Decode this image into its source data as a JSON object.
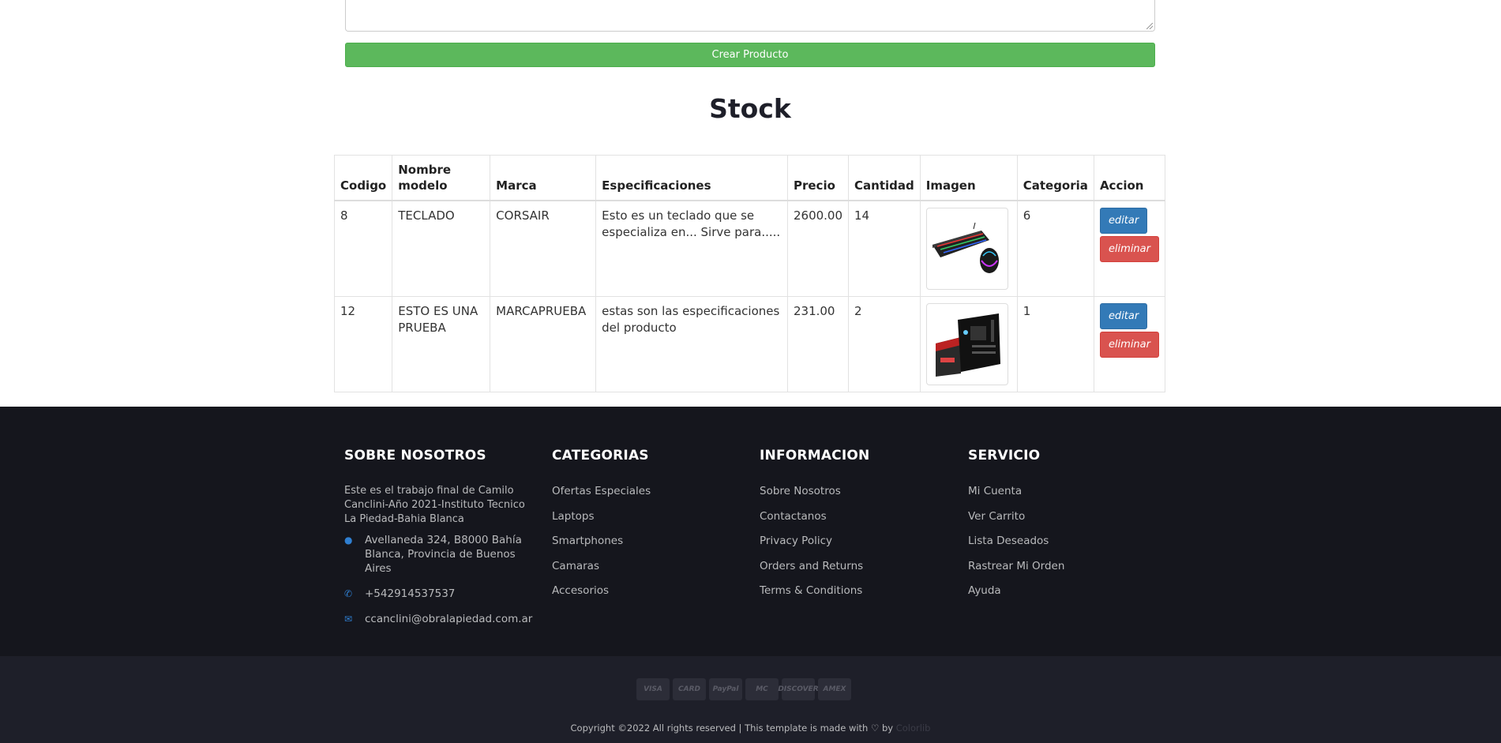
{
  "form": {
    "create_button": "Crear Producto"
  },
  "stock": {
    "title": "Stock",
    "columns": [
      "Codigo",
      "Nombre modelo",
      "Marca",
      "Especificaciones",
      "Precio",
      "Cantidad",
      "Imagen",
      "Categoria",
      "Accion"
    ],
    "rows": [
      {
        "codigo": "8",
        "nombre": "TECLADO",
        "marca": "CORSAIR",
        "especificaciones": "Esto es un teclado que se especializa en... Sirve para.....",
        "precio": "2600.00",
        "cantidad": "14",
        "imagen": "keyboard-mouse-icon",
        "categoria": "6",
        "edit_label": "editar",
        "delete_label": "eliminar"
      },
      {
        "codigo": "12",
        "nombre": "ESTO ES UNA PRUEBA",
        "marca": "MARCAPRUEBA",
        "especificaciones": "estas son las especificaciones del producto",
        "precio": "231.00",
        "cantidad": "2",
        "imagen": "motherboard-box-icon",
        "categoria": "1",
        "edit_label": "editar",
        "delete_label": "eliminar"
      }
    ]
  },
  "footer": {
    "about": {
      "heading": "SOBRE NOSOTROS",
      "text": "Este es el trabajo final de Camilo Canclini-Año 2021-Instituto Tecnico La Piedad-Bahia Blanca",
      "address": "Avellaneda 324, B8000 Bahía Blanca, Provincia de Buenos Aires",
      "phone": "+542914537537",
      "email": "ccanclini@obralapiedad.com.ar"
    },
    "categories": {
      "heading": "CATEGORIAS",
      "items": [
        "Ofertas Especiales",
        "Laptops",
        "Smartphones",
        "Camaras",
        "Accesorios"
      ]
    },
    "information": {
      "heading": "INFORMACION",
      "items": [
        "Sobre Nosotros",
        "Contactanos",
        "Privacy Policy",
        "Orders and Returns",
        "Terms & Conditions"
      ]
    },
    "service": {
      "heading": "SERVICIO",
      "items": [
        "Mi Cuenta",
        "Ver Carrito",
        "Lista Deseados",
        "Rastrear Mi Orden",
        "Ayuda"
      ]
    },
    "payments": [
      "VISA",
      "CARD",
      "PayPal",
      "MC",
      "DISCOVER",
      "AMEX"
    ],
    "copyright": "Copyright ©2022 All rights reserved | This template is made with",
    "copyright_by": "by",
    "brand": "Colorlib",
    "accent_color": "#2f7fd1"
  }
}
